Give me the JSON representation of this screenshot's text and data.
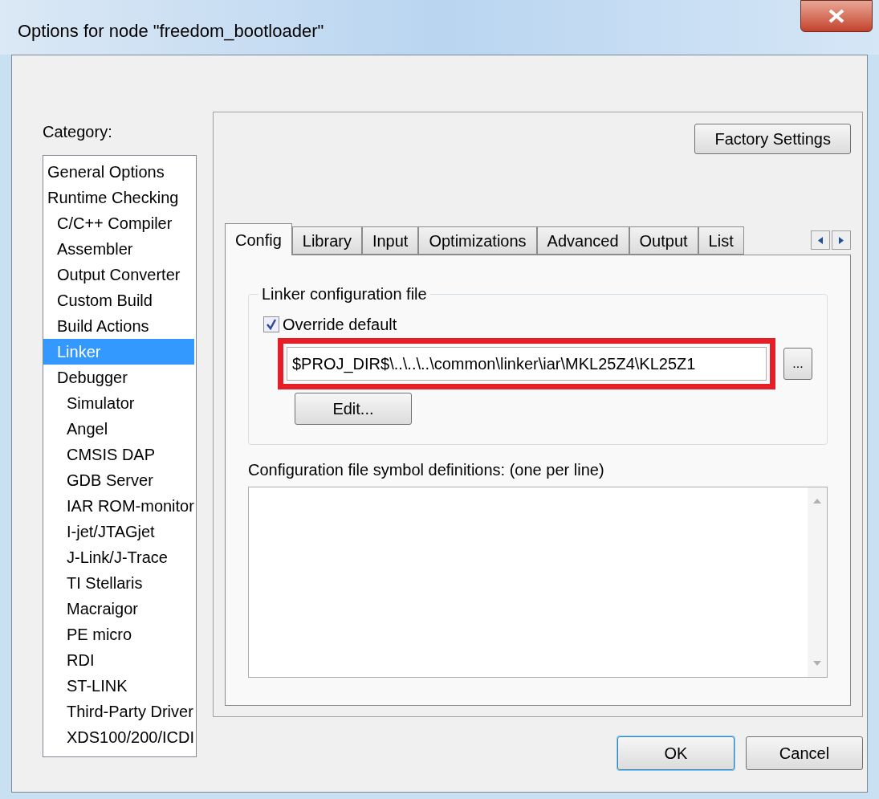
{
  "window": {
    "title": "Options for node \"freedom_bootloader\""
  },
  "category": {
    "label": "Category:",
    "items": [
      {
        "label": "General Options",
        "selected": false
      },
      {
        "label": "Runtime Checking",
        "selected": false,
        "children": [
          {
            "label": "C/C++ Compiler",
            "selected": false
          },
          {
            "label": "Assembler",
            "selected": false
          },
          {
            "label": "Output Converter",
            "selected": false
          },
          {
            "label": "Custom Build",
            "selected": false
          },
          {
            "label": "Build Actions",
            "selected": false
          },
          {
            "label": "Linker",
            "selected": true
          },
          {
            "label": "Debugger",
            "selected": false,
            "children": [
              {
                "label": "Simulator",
                "selected": false
              },
              {
                "label": "Angel",
                "selected": false
              },
              {
                "label": "CMSIS DAP",
                "selected": false
              },
              {
                "label": "GDB Server",
                "selected": false
              },
              {
                "label": "IAR ROM-monitor",
                "selected": false
              },
              {
                "label": "I-jet/JTAGjet",
                "selected": false
              },
              {
                "label": "J-Link/J-Trace",
                "selected": false
              },
              {
                "label": "TI Stellaris",
                "selected": false
              },
              {
                "label": "Macraigor",
                "selected": false
              },
              {
                "label": "PE micro",
                "selected": false
              },
              {
                "label": "RDI",
                "selected": false
              },
              {
                "label": "ST-LINK",
                "selected": false
              },
              {
                "label": "Third-Party Driver",
                "selected": false
              },
              {
                "label": "XDS100/200/ICDI",
                "selected": false
              }
            ]
          }
        ]
      }
    ]
  },
  "factory_settings_button": "Factory Settings",
  "tabs": [
    {
      "label": "Config",
      "selected": true
    },
    {
      "label": "Library",
      "selected": false
    },
    {
      "label": "Input",
      "selected": false
    },
    {
      "label": "Optimizations",
      "selected": false
    },
    {
      "label": "Advanced",
      "selected": false
    },
    {
      "label": "Output",
      "selected": false
    },
    {
      "label": "List",
      "selected": false
    }
  ],
  "linker_config": {
    "title": "Linker configuration file",
    "override": {
      "label": "Override default",
      "checked": true
    },
    "path": "$PROJ_DIR$\\..\\..\\..\\common\\linker\\iar\\MKL25Z4\\KL25Z1",
    "browse_button": "...",
    "edit_button": "Edit...",
    "highlighted": true
  },
  "symbol_definitions": {
    "label": "Configuration file symbol definitions: (one per line)"
  },
  "buttons": [
    "OK",
    "Cancel"
  ]
}
